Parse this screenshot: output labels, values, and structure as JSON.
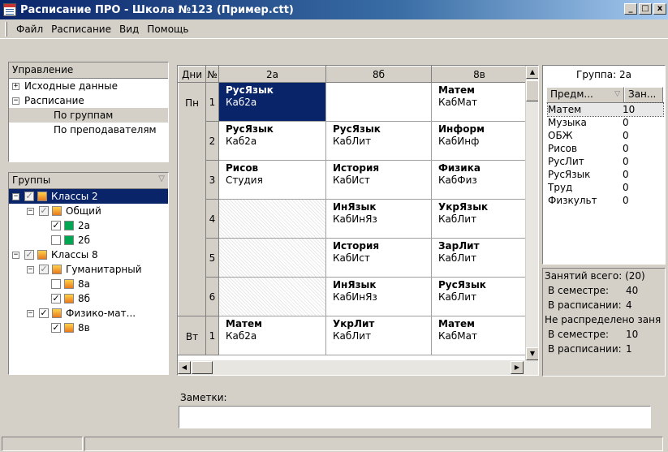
{
  "window": {
    "title": "Расписание ПРО - Школа №123 (Пример.ctt)",
    "buttons": [
      "_",
      "□",
      "x"
    ]
  },
  "menu": [
    "Файл",
    "Расписание",
    "Вид",
    "Помощь"
  ],
  "control_panel": {
    "header": "Управление",
    "items": [
      {
        "label": "Исходные данные",
        "expander": "+"
      },
      {
        "label": "Расписание",
        "expander": "−"
      },
      {
        "label": "По группам"
      },
      {
        "label": "По преподавателям"
      }
    ]
  },
  "groups_panel": {
    "header": "Группы",
    "filter_icon": "filter-icon",
    "items": [
      {
        "label": "Классы 2"
      },
      {
        "label": "Общий"
      },
      {
        "label": "2а"
      },
      {
        "label": "2б"
      },
      {
        "label": "Классы 8"
      },
      {
        "label": "Гуманитарный"
      },
      {
        "label": "8а"
      },
      {
        "label": "8б"
      },
      {
        "label": "Физико-мат..."
      },
      {
        "label": "8в"
      }
    ]
  },
  "schedule": {
    "headers": [
      "Дни",
      "№",
      "2а",
      "8б",
      "8в"
    ],
    "days": [
      {
        "day": "Пн",
        "lessons": [
          {
            "num": "1",
            "cells": [
              {
                "subject": "РусЯзык",
                "room": "Каб2а"
              },
              {
                "subject": "",
                "room": ""
              },
              {
                "subject": "Матем",
                "room": "КабМат"
              }
            ]
          },
          {
            "num": "2",
            "cells": [
              {
                "subject": "РусЯзык",
                "room": "Каб2а"
              },
              {
                "subject": "РусЯзык",
                "room": "КабЛит"
              },
              {
                "subject": "Информ",
                "room": "КабИнф"
              }
            ]
          },
          {
            "num": "3",
            "cells": [
              {
                "subject": "Рисов",
                "room": "Студия"
              },
              {
                "subject": "История",
                "room": "КабИст"
              },
              {
                "subject": "Физика",
                "room": "КабФиз"
              }
            ]
          },
          {
            "num": "4",
            "cells": [
              {
                "subject": "",
                "room": ""
              },
              {
                "subject": "ИнЯзык",
                "room": "КабИнЯз"
              },
              {
                "subject": "УкрЯзык",
                "room": "КабЛит"
              }
            ]
          },
          {
            "num": "5",
            "cells": [
              {
                "subject": "",
                "room": ""
              },
              {
                "subject": "История",
                "room": "КабИст"
              },
              {
                "subject": "ЗарЛит",
                "room": "КабЛит"
              }
            ]
          },
          {
            "num": "6",
            "cells": [
              {
                "subject": "",
                "room": ""
              },
              {
                "subject": "ИнЯзык",
                "room": "КабИнЯз"
              },
              {
                "subject": "РусЯзык",
                "room": "КабЛит"
              }
            ]
          }
        ]
      },
      {
        "day": "Вт",
        "lessons": [
          {
            "num": "1",
            "cells": [
              {
                "subject": "Матем",
                "room": "Каб2а"
              },
              {
                "subject": "УкрЛит",
                "room": "КабЛит"
              },
              {
                "subject": "Матем",
                "room": "КабМат"
              }
            ]
          }
        ]
      }
    ]
  },
  "group_info": {
    "title": "Группа: 2а",
    "col_subject": "Предм...",
    "col_count": "Зан...",
    "rows": [
      {
        "subject": "Матем",
        "count": "10"
      },
      {
        "subject": "Музыка",
        "count": "0"
      },
      {
        "subject": "ОБЖ",
        "count": "0"
      },
      {
        "subject": "Рисов",
        "count": "0"
      },
      {
        "subject": "РусЛит",
        "count": "0"
      },
      {
        "subject": "РусЯзык",
        "count": "0"
      },
      {
        "subject": "Труд",
        "count": "0"
      },
      {
        "subject": "Физкульт",
        "count": "0"
      }
    ]
  },
  "stats": {
    "total_header": "Занятий всего: (20)",
    "in_semester_label": "В семестре:",
    "in_semester_value": "40",
    "in_schedule_label": "В расписании:",
    "in_schedule_value": "4",
    "unassigned_header": "Не распределено заня",
    "un_semester_label": "В семестре:",
    "un_semester_value": "10",
    "un_schedule_label": "В расписании:",
    "un_schedule_value": "1"
  },
  "notes": {
    "label": "Заметки:"
  },
  "colors": {
    "selection": "#0a246a",
    "face": "#d4d0c8",
    "title_gradient_start": "#0a246a",
    "title_gradient_end": "#a6caf0"
  }
}
